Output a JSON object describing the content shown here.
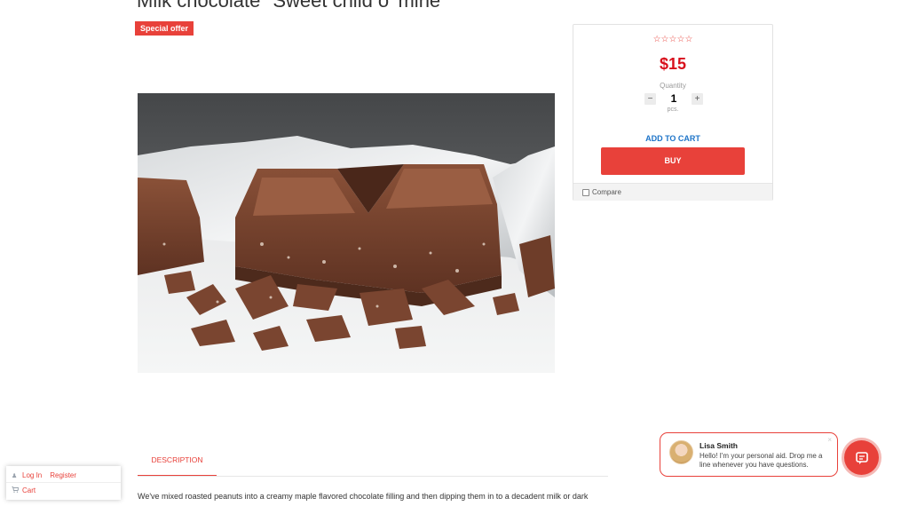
{
  "product": {
    "title": "Milk chocolate \"Sweet child o' mine\"",
    "badge": "Special offer",
    "image_icon": "chocolate-bar-photo"
  },
  "buy_box": {
    "rating": "☆☆☆☆☆",
    "rating_value": 0,
    "price": "$15",
    "quantity_label": "Quantity",
    "quantity_minus": "−",
    "quantity_value": "1",
    "quantity_plus": "+",
    "quantity_unit": "pcs.",
    "add_to_cart": "ADD TO CART",
    "buy": "BUY",
    "compare": "Compare"
  },
  "tabs": {
    "description": "DESCRIPTION",
    "description_text": "We've mixed roasted peanuts into a creamy maple flavored chocolate filling and then dipping them in to a decadent milk or dark"
  },
  "account": {
    "login": "Log In",
    "register": "Register",
    "cart": "Cart"
  },
  "chat": {
    "name": "Lisa Smith",
    "message": "Hello! I'm your personal aid. Drop me a line whenever you have questions.",
    "close": "×"
  },
  "colors": {
    "accent": "#e8413a",
    "price": "#d8101c",
    "link": "#1e74c8"
  }
}
